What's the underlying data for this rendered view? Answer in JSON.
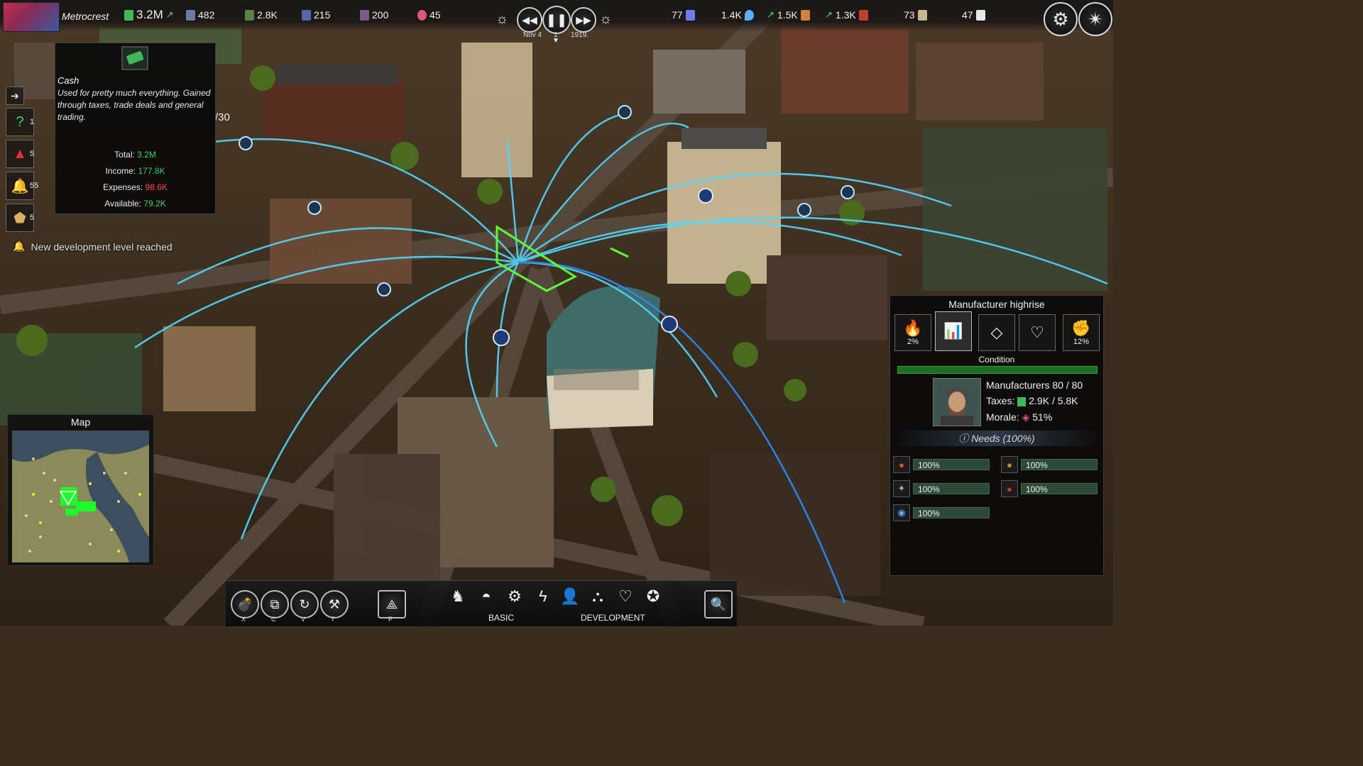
{
  "topbar": {
    "city_name": "Metrocrest",
    "resources": [
      {
        "id": "cash",
        "value": "3.2M",
        "color": "#3fb85a",
        "icon": "cash-icon",
        "trend": "up"
      },
      {
        "id": "pop-1",
        "value": "482",
        "color": "#6a7aa0",
        "icon": "worker-icon"
      },
      {
        "id": "pop-2",
        "value": "2.8K",
        "color": "#5b7f4a",
        "icon": "manufacturer-icon"
      },
      {
        "id": "pop-3",
        "value": "215",
        "color": "#5566aa",
        "icon": "clerk-icon"
      },
      {
        "id": "pop-4",
        "value": "200",
        "color": "#7a5a88",
        "icon": "elite-icon"
      },
      {
        "id": "influence",
        "value": "45",
        "color": "#d8577a",
        "icon": "heart-shield-icon"
      }
    ],
    "right_resources": [
      {
        "id": "power",
        "value": "77",
        "color": "#6f7cf0",
        "icon": "lightning-icon"
      },
      {
        "id": "water",
        "value": "1.4K",
        "color": "#5ab0ff",
        "icon": "water-drop-icon"
      },
      {
        "id": "bread",
        "value": "1.5K",
        "color": "#d0813a",
        "icon": "bread-icon",
        "trend": "up"
      },
      {
        "id": "meat",
        "value": "1.3K",
        "color": "#c04030",
        "icon": "meat-icon",
        "trend": "up"
      },
      {
        "id": "goods",
        "value": "73",
        "color": "#c8b890",
        "icon": "goods-icon"
      },
      {
        "id": "paper",
        "value": "47",
        "color": "#e8e8e8",
        "icon": "paper-icon"
      }
    ],
    "date_left": "Nov 4",
    "speed": "1",
    "date_right": "1919."
  },
  "left_column": [
    {
      "id": "collapse",
      "icon": "arrow-right-icon",
      "count": ""
    },
    {
      "id": "quests",
      "icon": "question-gear-icon",
      "count": "1"
    },
    {
      "id": "warnings",
      "icon": "warning-icon",
      "count": "5"
    },
    {
      "id": "notifications",
      "icon": "bell-icon",
      "count": "55"
    },
    {
      "id": "ranks",
      "icon": "rank-badge-icon",
      "count": "5"
    }
  ],
  "notice": "New development level reached",
  "partial_text": "/30",
  "tooltip": {
    "title": "Cash",
    "description": "Used for pretty much everything. Gained through taxes, trade deals and general trading.",
    "total_label": "Total:",
    "total_value": "3.2M",
    "income_label": "Income:",
    "income_value": "177.8K",
    "expenses_label": "Expenses:",
    "expenses_value": "98.6K",
    "available_label": "Available:",
    "available_value": "79.2K"
  },
  "map": {
    "title": "Map"
  },
  "panel": {
    "title": "Manufacturer highrise",
    "tabs": [
      {
        "icon": "fire-icon",
        "pct": "2%"
      },
      {
        "icon": "bar-chart-icon",
        "pct": ""
      },
      {
        "icon": "diamond-icon",
        "pct": ""
      },
      {
        "icon": "broken-heart-icon",
        "pct": ""
      },
      {
        "icon": "crime-icon",
        "pct": "12%"
      }
    ],
    "condition_label": "Condition",
    "condition_level": 1.0,
    "residents": "Manufacturers 80 / 80",
    "taxes_label": "Taxes:",
    "taxes_value": "2.9K / 5.8K",
    "morale_label": "Morale:",
    "morale_value": "51%",
    "needs_header": "Needs (100%)",
    "needs": [
      {
        "icon": "bread-icon",
        "color": "#d05a2a",
        "value": "100%"
      },
      {
        "icon": "meat-icon",
        "color": "#c88a3a",
        "value": "100%"
      },
      {
        "icon": "tools-icon",
        "color": "#aaaaaa",
        "value": "100%"
      },
      {
        "icon": "beef-icon",
        "color": "#c04030",
        "value": "100%"
      },
      {
        "icon": "water-drop-icon",
        "color": "#5ab0ff",
        "value": "100%"
      }
    ]
  },
  "bottom": {
    "tools": [
      {
        "icon": "demolish-icon",
        "key": "X"
      },
      {
        "icon": "copy-icon",
        "key": "C"
      },
      {
        "icon": "rotate-icon",
        "key": "V"
      },
      {
        "icon": "hammer-icon",
        "key": "T"
      },
      {
        "icon": "compass-icon",
        "key": "P"
      }
    ],
    "categories": [
      "horse-icon",
      "sun-horizon-icon",
      "gear-icon",
      "lightning-icon",
      "person-icon",
      "road-icon",
      "heart-icon",
      "police-badge-icon"
    ],
    "basic_label": "BASIC",
    "development_label": "DEVELOPMENT",
    "inspect_icon": "magnify-gear-icon"
  }
}
